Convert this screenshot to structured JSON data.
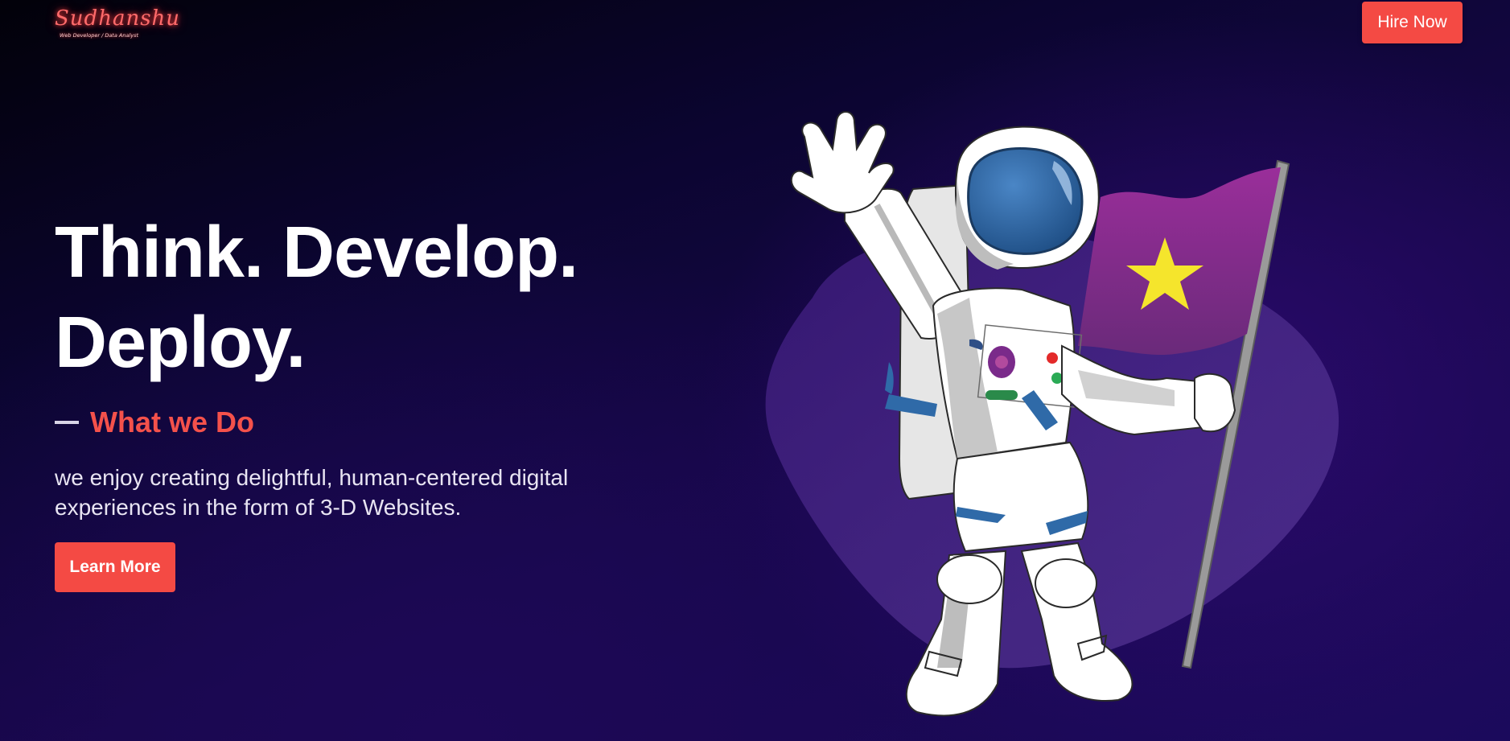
{
  "header": {
    "logo_name": "Sudhanshu",
    "logo_tagline": "Web Developer / Data Analyst",
    "hire_label": "Hire Now"
  },
  "hero": {
    "title_line1": "Think. Develop.",
    "title_line2": "Deploy.",
    "eyebrow": "What we Do",
    "description": "we enjoy creating delightful, human-centered digital experiences in the form of 3-D Websites.",
    "cta_label": "Learn More"
  },
  "illustration": {
    "subject": "astronaut-holding-flag",
    "icon": "astronaut-icon"
  },
  "colors": {
    "accent": "#f44a44",
    "background_dark": "#05020f",
    "background_purple": "#1b0a5c",
    "flag": "#8e2a8f",
    "star": "#f5e52c",
    "visor": "#2f6aa8"
  }
}
